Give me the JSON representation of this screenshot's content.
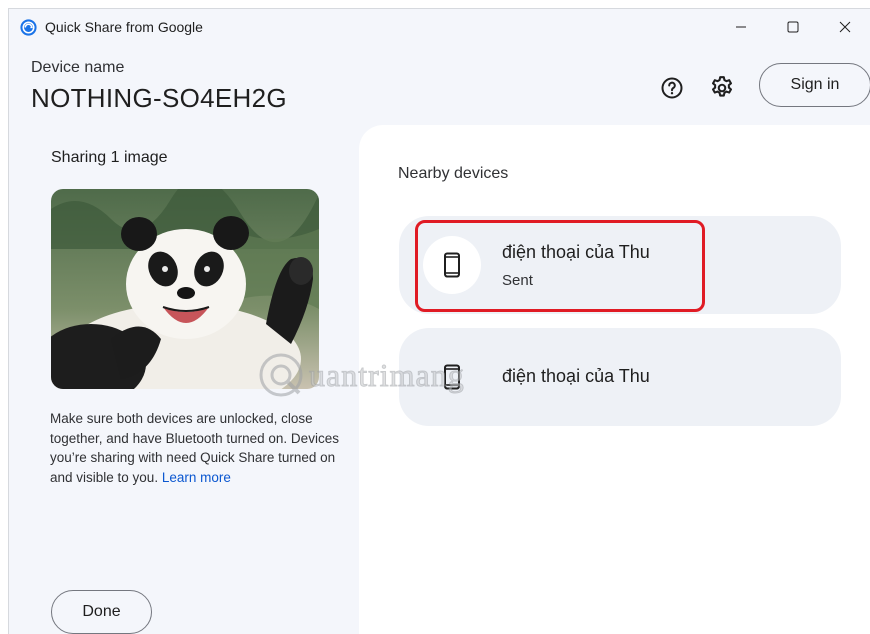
{
  "window": {
    "title": "Quick Share from Google",
    "controls": {
      "minimize_icon": "minimize-icon",
      "maximize_icon": "maximize-icon",
      "close_icon": "close-icon"
    }
  },
  "header": {
    "device_label": "Device name",
    "device_name": "NOTHING-SO4EH2G",
    "sign_in_label": "Sign in",
    "help_icon": "help-circle-icon",
    "settings_icon": "gear-icon"
  },
  "left_panel": {
    "sharing_title": "Sharing 1 image",
    "image_subject": "panda",
    "info_text": "Make sure both devices are unlocked, close together, and have Bluetooth turned on. Devices you’re sharing with need Quick Share turned on and visible to you.",
    "learn_more_label": "Learn more",
    "done_label": "Done"
  },
  "right_panel": {
    "nearby_title": "Nearby devices",
    "devices": [
      {
        "name": "điện thoại của Thu",
        "status": "Sent",
        "icon": "phone-icon",
        "highlighted": true
      },
      {
        "name": "điện thoại của Thu",
        "status": "",
        "icon": "phone-icon",
        "highlighted": false
      }
    ]
  },
  "watermark": {
    "text": "uantrimang"
  },
  "colors": {
    "accent": "#0b57d0",
    "window_bg": "#f4f6fb",
    "card_bg": "#eef1f6",
    "highlight": "#e01b24"
  }
}
